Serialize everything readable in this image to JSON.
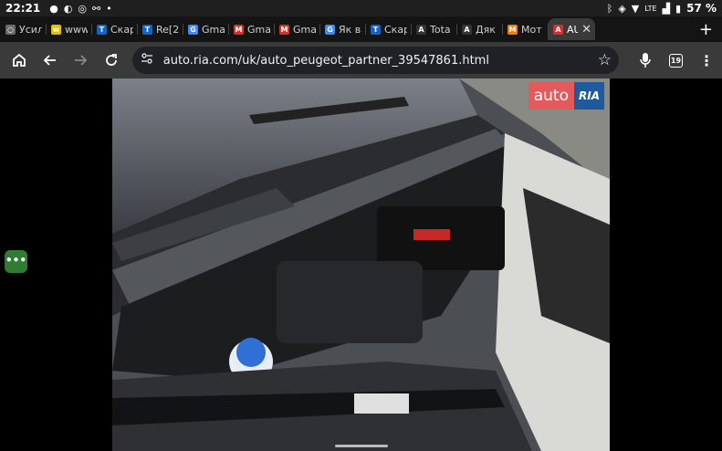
{
  "status_bar": {
    "time": "22:21",
    "icons": [
      "message-icon",
      "chat-icon",
      "whatsapp-icon",
      "usb-icon",
      "dot-icon"
    ],
    "right_icons": [
      "bluetooth-icon",
      "nfc-icon",
      "wifi-icon",
      "signal-icon"
    ],
    "network": "LTE",
    "battery": "57 %"
  },
  "tabs": [
    {
      "label": "Усиле",
      "icon": "circle-icon",
      "color": "#6b6b6b",
      "glyph": "○"
    },
    {
      "label": "www",
      "icon": "www-logo-icon",
      "color": "#e6c000",
      "glyph": "w"
    },
    {
      "label": "Скар",
      "icon": "t-logo-icon",
      "color": "#1565c0",
      "glyph": "T"
    },
    {
      "label": "Re[2",
      "icon": "t-logo-icon",
      "color": "#1565c0",
      "glyph": "T"
    },
    {
      "label": "Gma",
      "icon": "google-icon",
      "color": "#4285f4",
      "glyph": "G"
    },
    {
      "label": "Gma",
      "icon": "gmail-icon",
      "color": "#d93025",
      "glyph": "M"
    },
    {
      "label": "Gma",
      "icon": "gmail-icon",
      "color": "#d93025",
      "glyph": "M"
    },
    {
      "label": "Як в",
      "icon": "google-icon",
      "color": "#4285f4",
      "glyph": "G"
    },
    {
      "label": "Скар",
      "icon": "t-logo-icon",
      "color": "#1565c0",
      "glyph": "T"
    },
    {
      "label": "Tota",
      "icon": "ao-logo-icon",
      "color": "#333333",
      "glyph": "A"
    },
    {
      "label": "Дяк",
      "icon": "ao-logo-icon",
      "color": "#333333",
      "glyph": "A"
    },
    {
      "label": "Мот",
      "icon": "moto-logo-icon",
      "color": "#f57c00",
      "glyph": "M"
    },
    {
      "label": "AU",
      "icon": "autoria-logo-icon",
      "color": "#d32f2f",
      "glyph": "A",
      "active": true
    }
  ],
  "toolbar": {
    "url": "auto.ria.com/uk/auto_peugeot_partner_39547861.html",
    "tab_count": "19"
  },
  "page": {
    "bubble_text": "•••",
    "watermark_left": "auto",
    "watermark_right": "RIA"
  }
}
